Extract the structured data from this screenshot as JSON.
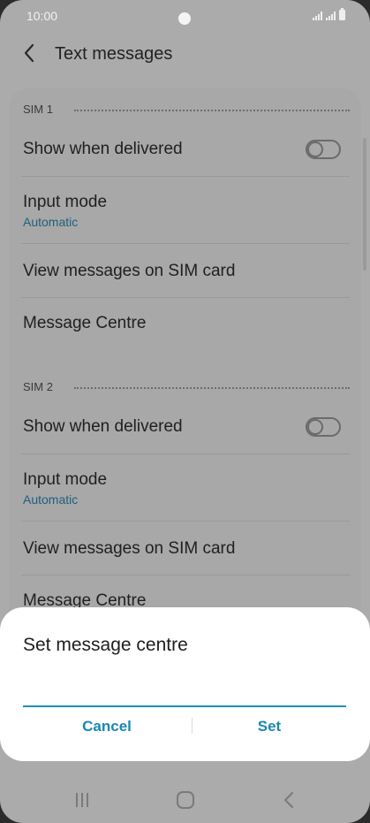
{
  "status_bar": {
    "time": "10:00"
  },
  "header": {
    "title": "Text messages",
    "back_icon": "chevron-left-icon"
  },
  "sim1": {
    "section_label": "SIM 1",
    "show_delivered_label": "Show when delivered",
    "show_delivered_on": false,
    "input_mode_label": "Input mode",
    "input_mode_value": "Automatic",
    "view_sim_label": "View messages on SIM card",
    "message_centre_label": "Message Centre"
  },
  "sim2": {
    "section_label": "SIM 2",
    "show_delivered_label": "Show when delivered",
    "show_delivered_on": false,
    "input_mode_label": "Input mode",
    "input_mode_value": "Automatic",
    "view_sim_label": "View messages on SIM card",
    "message_centre_label": "Message Centre"
  },
  "dialog": {
    "title": "Set message centre",
    "input_value": "",
    "cancel_label": "Cancel",
    "set_label": "Set"
  },
  "nav_bar": {
    "recents_icon": "recents-icon",
    "home_icon": "home-icon",
    "back_icon": "back-icon"
  },
  "colors": {
    "accent": "#1a88b0",
    "subtitle": "#1f5f7f",
    "dimmed_background": "#ababab",
    "dialog_background": "#ffffff"
  }
}
